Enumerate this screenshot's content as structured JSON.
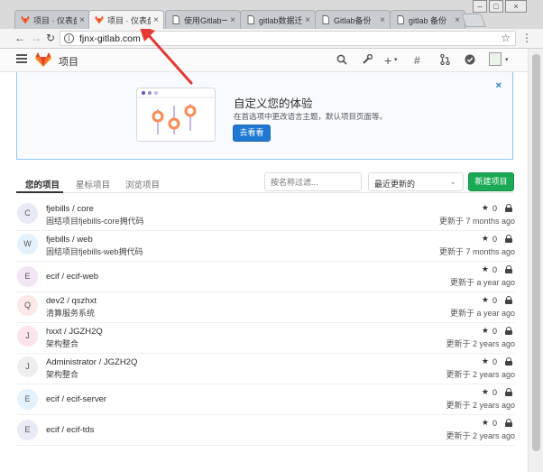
{
  "browser": {
    "tabs": [
      {
        "title": "项目 · 仪表盘",
        "icon": "gitlab-icon",
        "active": false
      },
      {
        "title": "项目 · 仪表盘",
        "icon": "gitlab-icon",
        "active": true
      },
      {
        "title": "使用Gitlab一",
        "icon": "page-icon",
        "active": false
      },
      {
        "title": "gitlab数据迁",
        "icon": "page-icon",
        "active": false
      },
      {
        "title": "Gitlab备份",
        "icon": "page-icon",
        "active": false
      },
      {
        "title": "gitlab 备份",
        "icon": "page-icon",
        "active": false
      }
    ],
    "close_glyph": "×",
    "url": "fjnx-gitlab.com"
  },
  "header": {
    "title": "项目"
  },
  "banner": {
    "title": "自定义您的体验",
    "text": "在首选项中更改语言主题，默认项目页面等。",
    "button": "去看看",
    "close": "×"
  },
  "tabs": {
    "yours": "您的项目",
    "starred": "星标项目",
    "explore": "浏览项目"
  },
  "filter": {
    "placeholder": "按名称过滤..."
  },
  "sort": {
    "selected": "最近更新的"
  },
  "new_project_button": "新建项目",
  "projects": [
    {
      "letter": "C",
      "name": "fjebills / core",
      "desc": "固结项目fjebills-core拥代码",
      "stars": "0",
      "updated": "更新于 7 months ago",
      "avatar_color": "#e8eaf6"
    },
    {
      "letter": "W",
      "name": "fjebills / web",
      "desc": "固结项目fjebills-web拥代码",
      "stars": "0",
      "updated": "更新于 7 months ago",
      "avatar_color": "#e3f2fd"
    },
    {
      "letter": "E",
      "name": "ecif / ecif-web",
      "desc": "",
      "stars": "0",
      "updated": "更新于 a year ago",
      "avatar_color": "#f3e5f5"
    },
    {
      "letter": "Q",
      "name": "dev2 / qszhxt",
      "desc": "清算服务系统",
      "stars": "0",
      "updated": "更新于 a year ago",
      "avatar_color": "#fbe9e7"
    },
    {
      "letter": "J",
      "name": "hxxt / JGZH2Q",
      "desc": "架构整合",
      "stars": "0",
      "updated": "更新于 2 years ago",
      "avatar_color": "#fce4ec"
    },
    {
      "letter": "J",
      "name": "Administrator / JGZH2Q",
      "desc": "架构整合",
      "stars": "0",
      "updated": "更新于 2 years ago",
      "avatar_color": "#eeeeee"
    },
    {
      "letter": "E",
      "name": "ecif / ecif-server",
      "desc": "",
      "stars": "0",
      "updated": "更新于 2 years ago",
      "avatar_color": "#e3f2fd"
    },
    {
      "letter": "E",
      "name": "ecif / ecif-tds",
      "desc": "",
      "stars": "0",
      "updated": "更新于 2 years ago",
      "avatar_color": "#e8eaf6"
    }
  ],
  "colors": {
    "gitlab_orange": "#e24329",
    "primary_blue": "#1f78d1",
    "success_green": "#1aaa55",
    "annotation_red": "#e53935"
  }
}
